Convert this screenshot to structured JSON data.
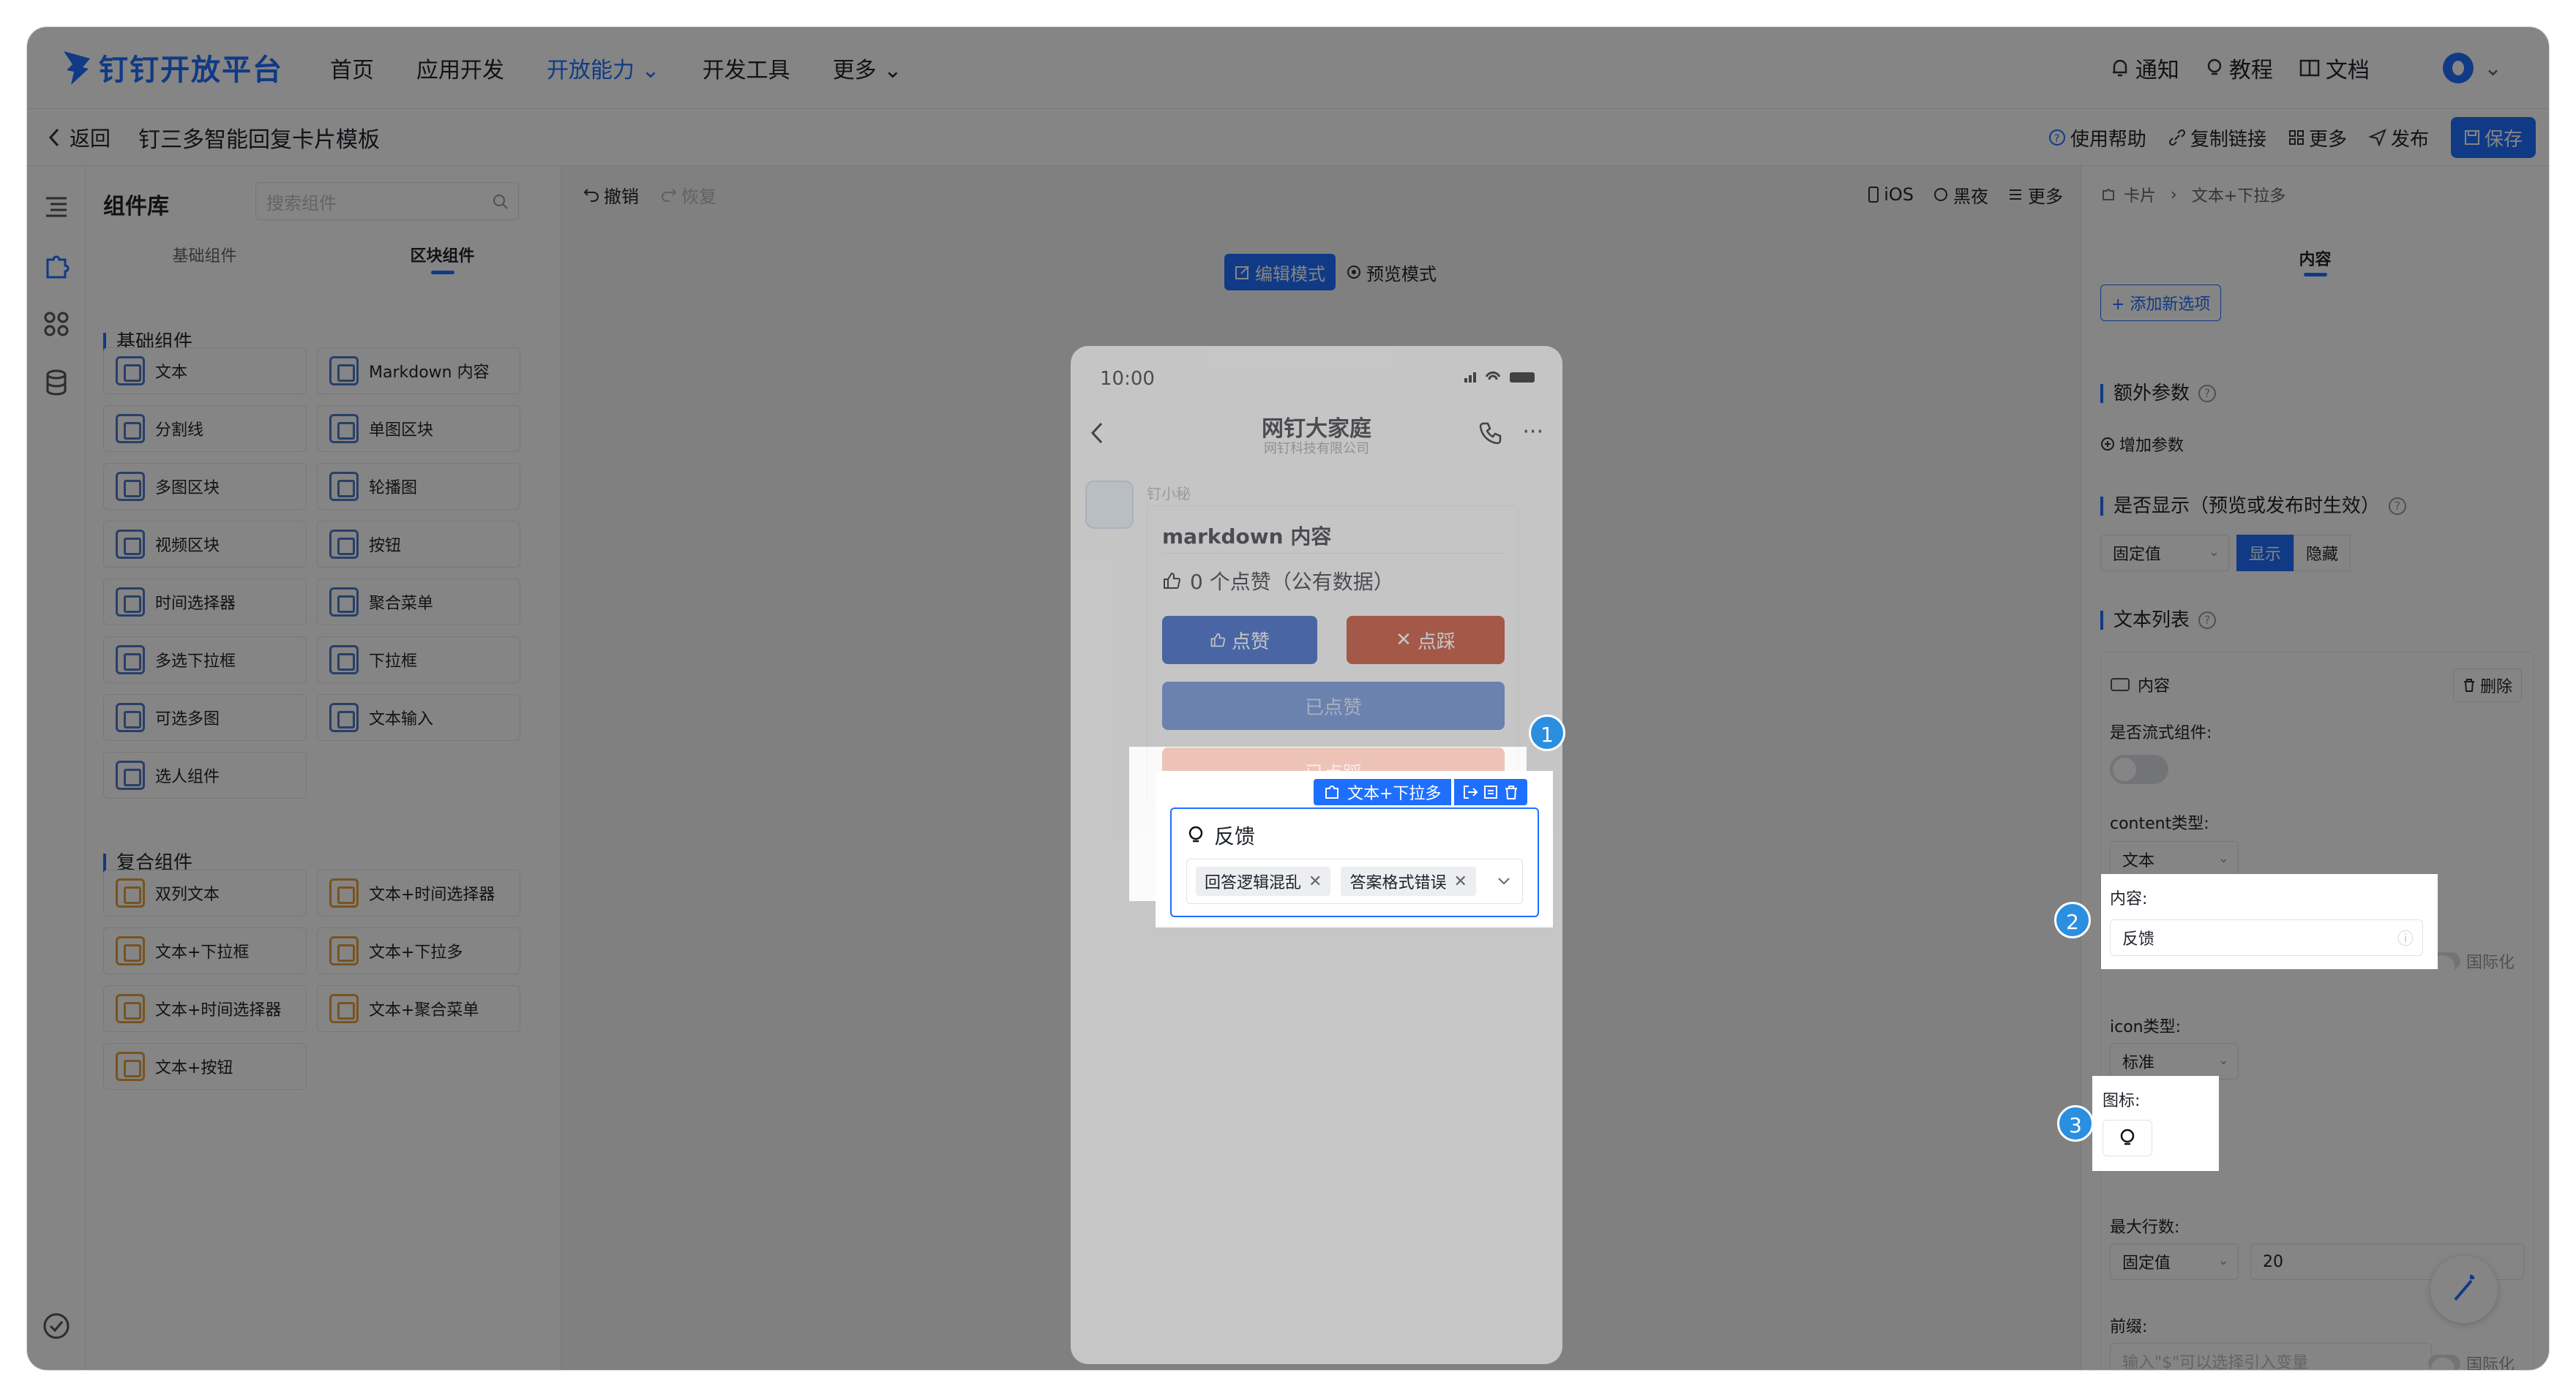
{
  "brand": {
    "name": "钉钉开放平台",
    "color": "#1f6fff"
  },
  "top_nav": {
    "items": [
      "首页",
      "应用开发",
      "开放能力",
      "开发工具",
      "更多"
    ],
    "active": "开放能力",
    "notify": "通知",
    "tutorial": "教程",
    "docs": "文档"
  },
  "sub_header": {
    "back": "返回",
    "title": "钉三多智能回复卡片模板",
    "help": "使用帮助",
    "copy_link": "复制链接",
    "more": "更多",
    "publish": "发布",
    "save": "保存"
  },
  "rail_icons": [
    "outline-icon",
    "puzzle-icon",
    "apps-icon",
    "database-icon",
    "check-circle-icon"
  ],
  "library": {
    "title": "组件库",
    "search_placeholder": "搜索组件",
    "tabs": [
      "基础组件",
      "区块组件"
    ],
    "active_tab": "区块组件",
    "basic_title": "基础组件",
    "basic": [
      "文本",
      "Markdown 内容",
      "分割线",
      "单图区块",
      "多图区块",
      "轮播图",
      "视频区块",
      "按钮",
      "时间选择器",
      "聚合菜单",
      "多选下拉框",
      "下拉框",
      "可选多图",
      "文本输入",
      "选人组件"
    ],
    "composite_title": "复合组件",
    "composite": [
      "双列文本",
      "文本+时间选择器",
      "文本+下拉框",
      "文本+下拉多",
      "文本+时间选择器",
      "文本+聚合菜单",
      "文本+按钮"
    ]
  },
  "canvas_toolbar": {
    "undo": "撤销",
    "redo": "恢复",
    "ios": "iOS",
    "dark": "黑夜",
    "more": "更多",
    "edit_mode": "编辑模式",
    "preview_mode": "预览模式"
  },
  "phone": {
    "time": "10:00",
    "chat_name": "网钉大家庭",
    "chat_sub": "网钉科技有限公司",
    "bot_name": "钉小秘"
  },
  "card": {
    "title": "markdown 内容",
    "likes": "0 个点赞（公有数据）",
    "like": "点赞",
    "dislike": "点踩",
    "liked": "已点赞",
    "disliked": "已点踩",
    "like_color": "#1f4fbf",
    "dislike_color": "#c0391b"
  },
  "feedback": {
    "toolbar_label": "文本+下拉多",
    "label": "反馈",
    "tags": [
      "回答逻辑混乱",
      "答案格式错误"
    ]
  },
  "right_panel": {
    "crumb": [
      "卡片",
      "文本+下拉多"
    ],
    "tab": "内容",
    "add_option": "+ 添加新选项",
    "extra_params": "额外参数",
    "add_param": "增加参数",
    "visible_title": "是否显示（预览或发布时生效）",
    "visible_source": "固定值",
    "show": "显示",
    "hide": "隐藏",
    "text_list": "文本列表",
    "item_title": "内容",
    "delete": "删除",
    "is_flow": "是否流式组件:",
    "content_type_label": "content类型:",
    "content_type": "文本",
    "content_label": "内容:",
    "content_value": "反馈",
    "i18n": "国际化",
    "icon_type_label": "icon类型:",
    "icon_type": "标准",
    "icon_label": "图标:",
    "max_lines_label": "最大行数:",
    "max_lines_source": "固定值",
    "max_lines": "20",
    "prefix_label": "前缀:",
    "prefix_placeholder": "输入\"$\"可以选择引入变量"
  },
  "badges": [
    "1",
    "2",
    "3"
  ]
}
